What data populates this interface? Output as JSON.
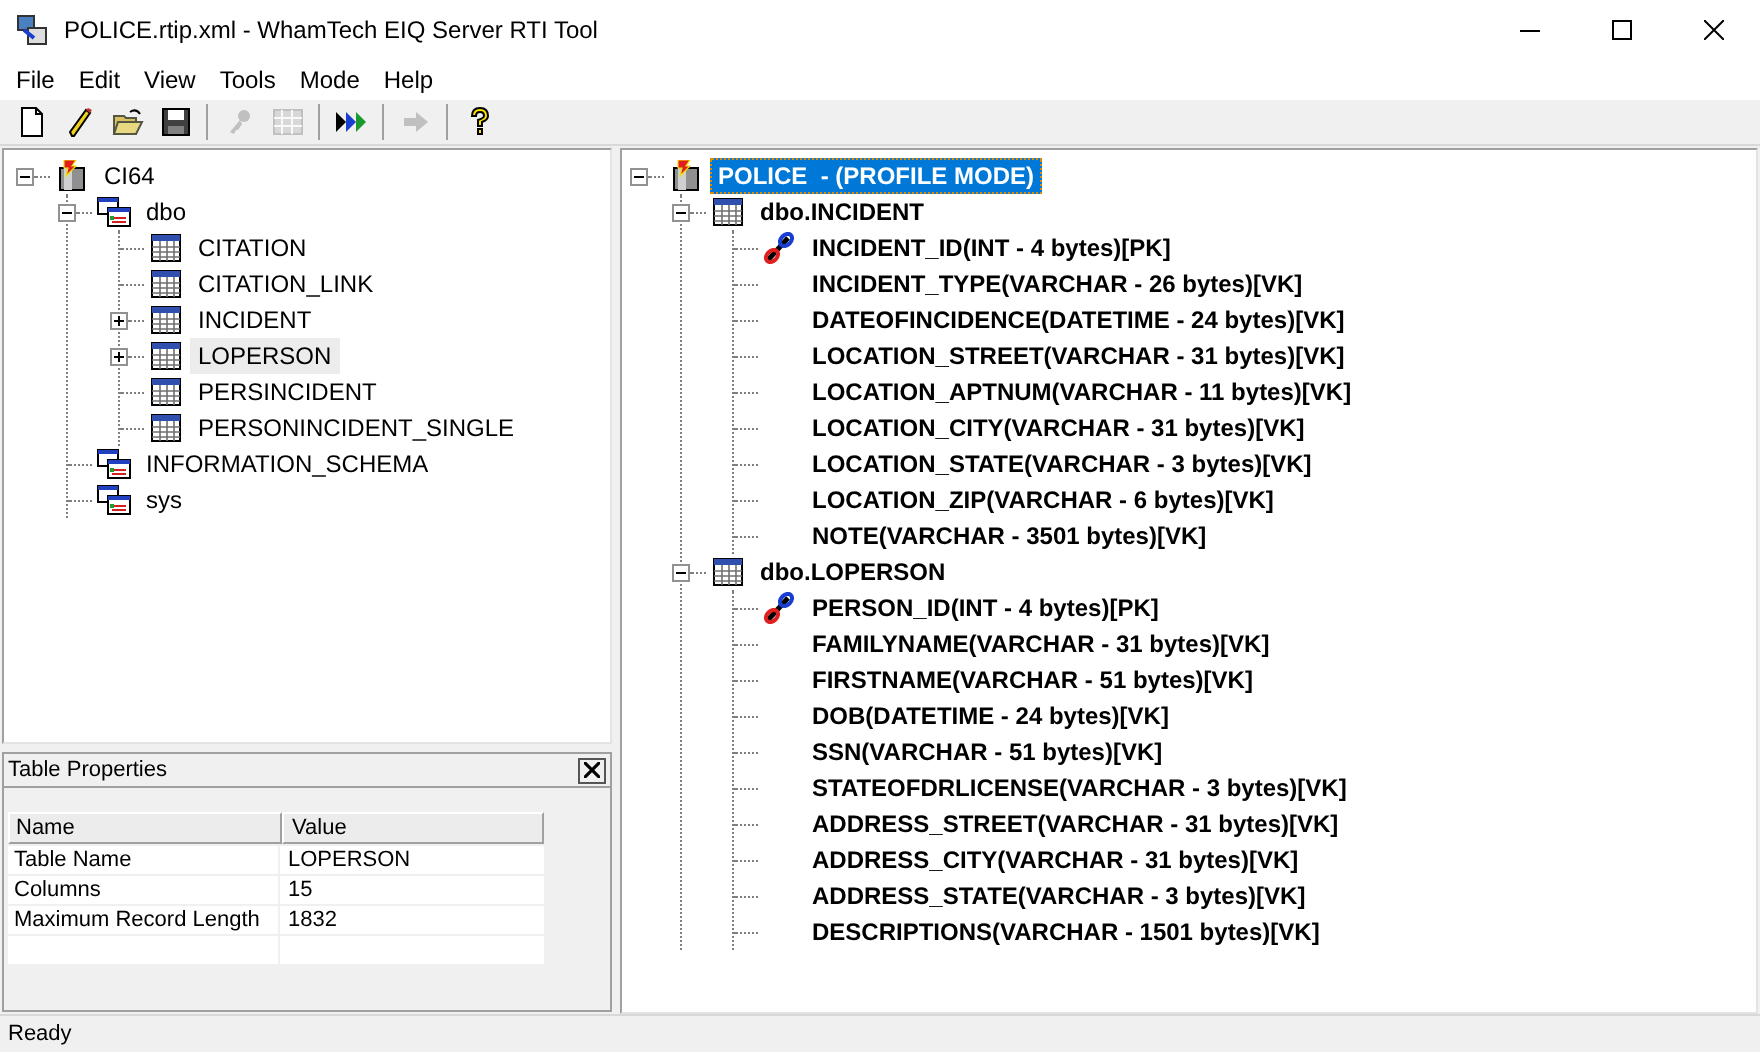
{
  "window": {
    "title": "POLICE.rtip.xml - WhamTech EIQ Server RTI Tool"
  },
  "menu": [
    "File",
    "Edit",
    "View",
    "Tools",
    "Mode",
    "Help"
  ],
  "toolbar": [
    {
      "kind": "new",
      "disabled": false
    },
    {
      "kind": "edit",
      "disabled": false
    },
    {
      "kind": "open",
      "disabled": false
    },
    {
      "kind": "save",
      "disabled": false
    },
    {
      "kind": "sep"
    },
    {
      "kind": "key",
      "disabled": true
    },
    {
      "kind": "grid",
      "disabled": true
    },
    {
      "kind": "sep"
    },
    {
      "kind": "run",
      "disabled": false
    },
    {
      "kind": "sep"
    },
    {
      "kind": "forward",
      "disabled": true
    },
    {
      "kind": "sep"
    },
    {
      "kind": "help",
      "disabled": false
    }
  ],
  "left_tree": {
    "focused": false,
    "nodes": [
      {
        "label": "CI64",
        "kind": "server",
        "selected": false,
        "expanded": true,
        "children": [
          {
            "label": "dbo",
            "kind": "schema",
            "selected": false,
            "expanded": true,
            "children": [
              {
                "label": "CITATION",
                "kind": "table",
                "selected": false
              },
              {
                "label": "CITATION_LINK",
                "kind": "table",
                "selected": false
              },
              {
                "label": "INCIDENT",
                "kind": "table",
                "selected": false,
                "expanded": false
              },
              {
                "label": "LOPERSON",
                "kind": "table",
                "selected": true,
                "expanded": false
              },
              {
                "label": "PERSINCIDENT",
                "kind": "table",
                "selected": false
              },
              {
                "label": "PERSONINCIDENT_SINGLE",
                "kind": "table",
                "selected": false
              }
            ]
          },
          {
            "label": "INFORMATION_SCHEMA",
            "kind": "schema",
            "selected": false
          },
          {
            "label": "sys",
            "kind": "schema",
            "selected": false
          }
        ]
      }
    ]
  },
  "properties": {
    "title": "Table Properties",
    "columns": [
      "Name",
      "Value"
    ],
    "rows": [
      [
        "Table Name",
        "LOPERSON"
      ],
      [
        "Columns",
        "15"
      ],
      [
        "Maximum Record Length",
        "1832"
      ]
    ]
  },
  "right_tree": {
    "focused": true,
    "nodes": [
      {
        "label": "POLICE  - (PROFILE MODE)",
        "kind": "server",
        "selected": true,
        "expanded": true,
        "children": [
          {
            "label": "dbo.INCIDENT",
            "kind": "table",
            "selected": false,
            "expanded": true,
            "children": [
              {
                "label": "INCIDENT_ID(INT - 4 bytes)[PK]",
                "kind": "pk",
                "selected": false
              },
              {
                "label": "INCIDENT_TYPE(VARCHAR - 26 bytes)[VK]",
                "kind": "column",
                "selected": false
              },
              {
                "label": "DATEOFINCIDENCE(DATETIME - 24 bytes)[VK]",
                "kind": "column",
                "selected": false
              },
              {
                "label": "LOCATION_STREET(VARCHAR - 31 bytes)[VK]",
                "kind": "column",
                "selected": false
              },
              {
                "label": "LOCATION_APTNUM(VARCHAR - 11 bytes)[VK]",
                "kind": "column",
                "selected": false
              },
              {
                "label": "LOCATION_CITY(VARCHAR - 31 bytes)[VK]",
                "kind": "column",
                "selected": false
              },
              {
                "label": "LOCATION_STATE(VARCHAR - 3 bytes)[VK]",
                "kind": "column",
                "selected": false
              },
              {
                "label": "LOCATION_ZIP(VARCHAR - 6 bytes)[VK]",
                "kind": "column",
                "selected": false
              },
              {
                "label": "NOTE(VARCHAR - 3501 bytes)[VK]",
                "kind": "column",
                "selected": false
              }
            ]
          },
          {
            "label": "dbo.LOPERSON",
            "kind": "table",
            "selected": false,
            "expanded": true,
            "children": [
              {
                "label": "PERSON_ID(INT - 4 bytes)[PK]",
                "kind": "pk",
                "selected": false
              },
              {
                "label": "FAMILYNAME(VARCHAR - 31 bytes)[VK]",
                "kind": "column",
                "selected": false
              },
              {
                "label": "FIRSTNAME(VARCHAR - 51 bytes)[VK]",
                "kind": "column",
                "selected": false
              },
              {
                "label": "DOB(DATETIME - 24 bytes)[VK]",
                "kind": "column",
                "selected": false
              },
              {
                "label": "SSN(VARCHAR - 51 bytes)[VK]",
                "kind": "column",
                "selected": false
              },
              {
                "label": "STATEOFDRLICENSE(VARCHAR - 3 bytes)[VK]",
                "kind": "column",
                "selected": false
              },
              {
                "label": "ADDRESS_STREET(VARCHAR - 31 bytes)[VK]",
                "kind": "column",
                "selected": false
              },
              {
                "label": "ADDRESS_CITY(VARCHAR - 31 bytes)[VK]",
                "kind": "column",
                "selected": false
              },
              {
                "label": "ADDRESS_STATE(VARCHAR - 3 bytes)[VK]",
                "kind": "column",
                "selected": false
              },
              {
                "label": "DESCRIPTIONS(VARCHAR - 1501 bytes)[VK]",
                "kind": "column",
                "selected": false
              }
            ]
          }
        ]
      }
    ]
  },
  "status_bar": "Ready"
}
